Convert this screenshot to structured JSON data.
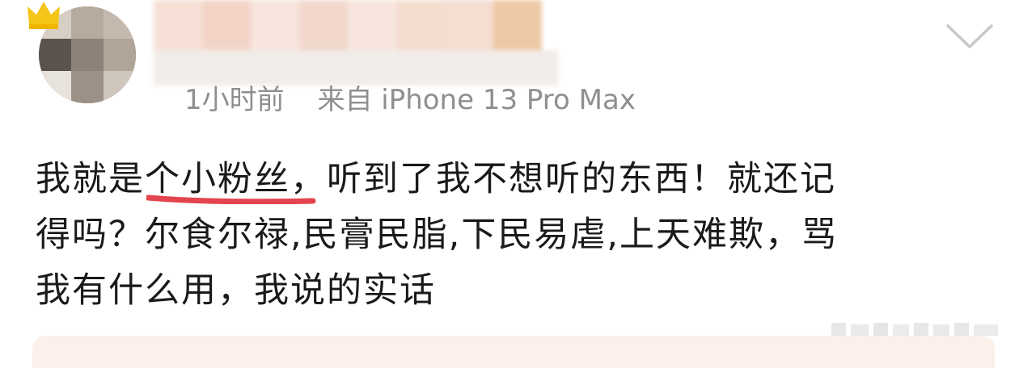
{
  "post": {
    "author": {
      "avatar_icon": "avatar-blurred",
      "badge_icon": "crown-icon",
      "badge_color": "#f5c518"
    },
    "meta": {
      "time": "1小时前",
      "source": "来自 iPhone 13 Pro Max"
    },
    "menu_icon": "chevron-down-icon",
    "content": {
      "line1_before": "我就是",
      "line1_highlight": "个小粉丝",
      "line1_after": "，听到了我不想听的东西！就还记",
      "line2": "得吗？尔食尔禄,民膏民脂,下民易虐,上天难欺，骂",
      "line3": "我有什么用，我说的实话",
      "highlight_color": "#e0303a"
    },
    "colors": {
      "text": "#1a1a1a",
      "meta": "#8f8f8f",
      "quote_bg": "#fbf0ea"
    }
  }
}
